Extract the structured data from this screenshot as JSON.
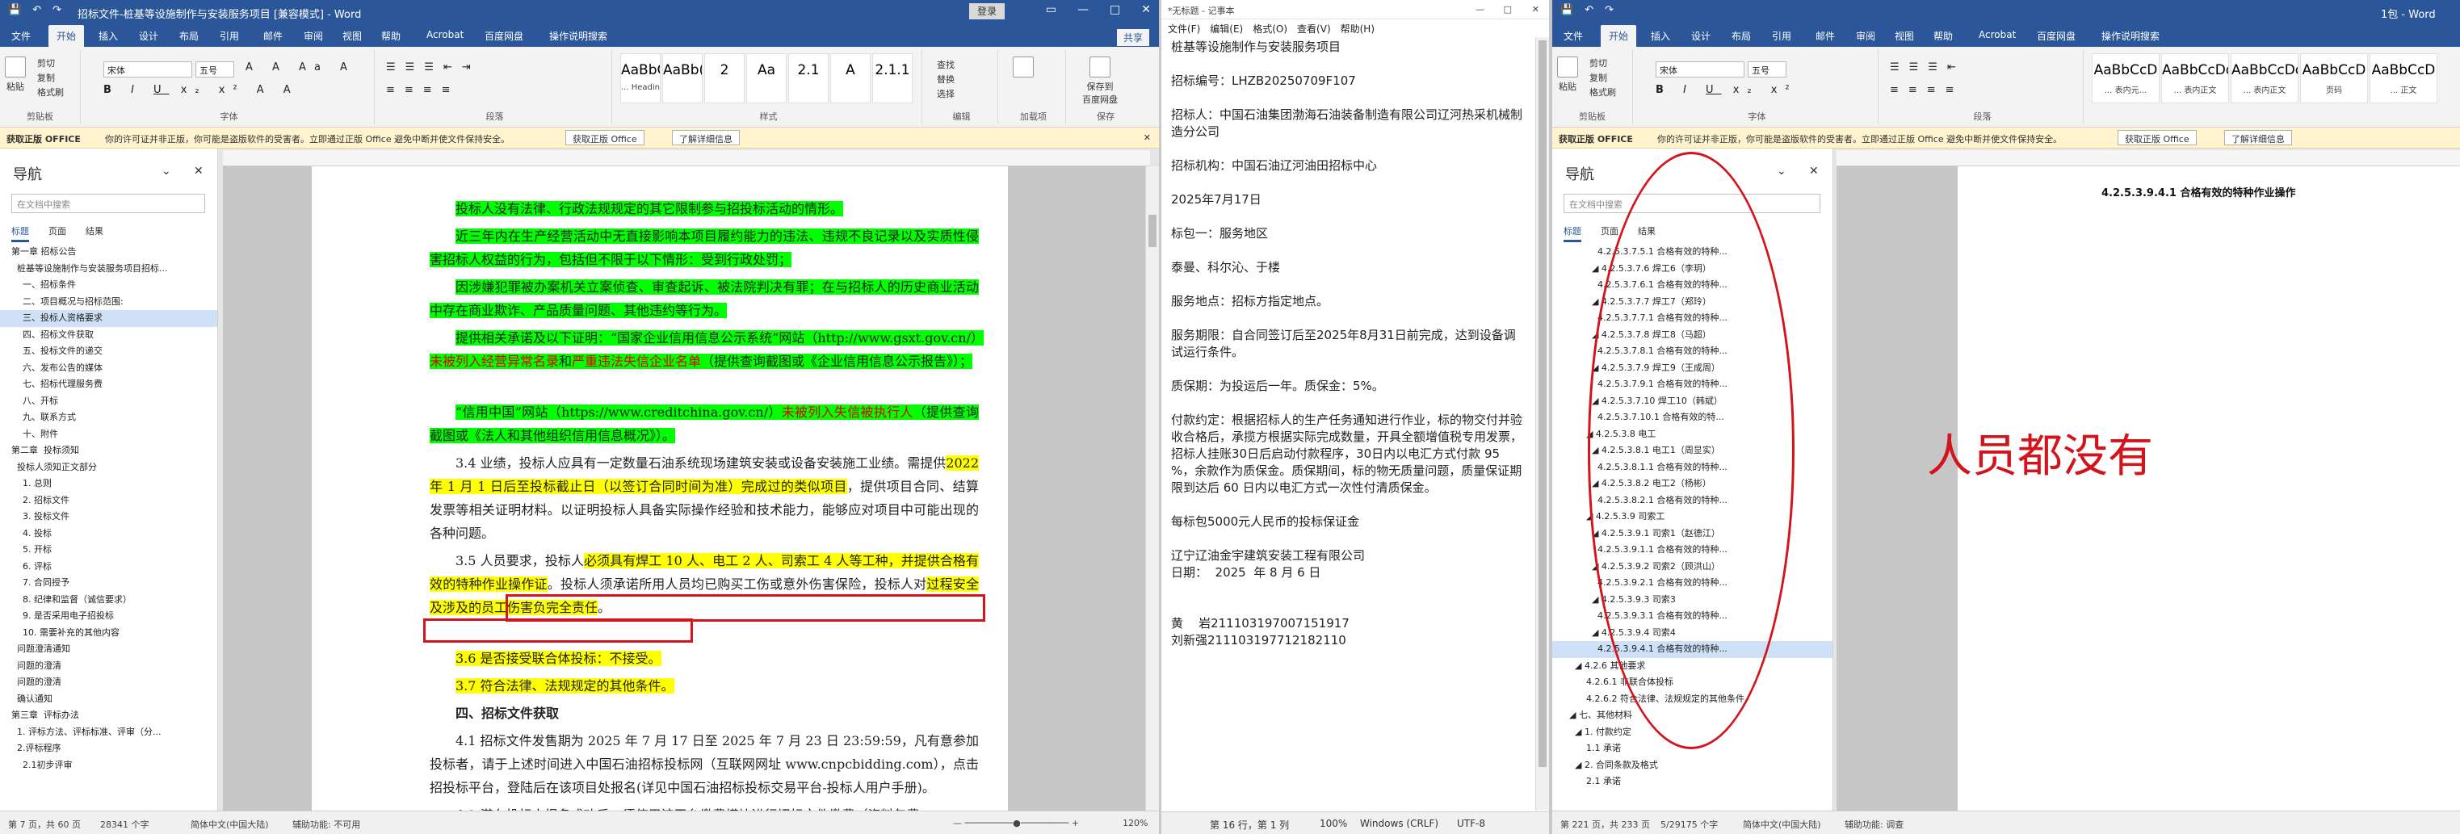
{
  "w1": {
    "title_left": "招标文件-桩基等设施制作与安装服务项目 [兼容模式] - Word",
    "login": "登录",
    "tabs": [
      "文件",
      "开始",
      "插入",
      "设计",
      "布局",
      "引用",
      "邮件",
      "审阅",
      "视图",
      "帮助",
      "Acrobat",
      "百度网盘",
      "操作说明搜索"
    ],
    "share": "共享",
    "clipboard": {
      "paste": "粘贴",
      "cut": "剪切",
      "copy": "复制",
      "format": "格式刷",
      "label": "剪贴板"
    },
    "font": {
      "name": "宋体",
      "size": "五号",
      "label": "字体"
    },
    "para_label": "段落",
    "styles": [
      {
        "sample": "AaBbCcI",
        "name": "... Headin..."
      },
      {
        "sample": "AaBb(",
        "name": ""
      },
      {
        "sample": "2",
        "name": ""
      },
      {
        "sample": "Aa",
        "name": ""
      },
      {
        "sample": "2.1",
        "name": ""
      },
      {
        "sample": "A",
        "name": ""
      },
      {
        "sample": "2.1.1",
        "name": ""
      }
    ],
    "styles_label": "样式",
    "edit": {
      "find": "查找",
      "replace": "替换",
      "select": "选择",
      "label": "编辑"
    },
    "addin": {
      "btn": "加载项",
      "label": "加载项"
    },
    "save": {
      "btn": "保存到\n百度网盘",
      "label": "保存"
    },
    "msg": {
      "prefix": "获取正版 OFFICE",
      "text": "你的许可证并非正版，你可能是盗版软件的受害者。立即通过正版 Office 避免中断并使文件保持安全。",
      "btn1": "获取正版 Office",
      "btn2": "了解详细信息"
    },
    "nav": {
      "title": "导航",
      "search": "在文档中搜索",
      "tabs": [
        "标题",
        "页面",
        "结果"
      ],
      "items": [
        "第一章 招标公告",
        "  桩基等设施制作与安装服务项目招标...",
        "    一、招标条件",
        "    二、项目概况与招标范围:",
        "    三、投标人资格要求",
        "    四、招标文件获取",
        "    五、投标文件的递交",
        "    六、发布公告的媒体",
        "    七、招标代理服务费",
        "    八、开标",
        "    九、联系方式",
        "    十、附件",
        "第二章  投标须知",
        "  投标人须知正文部分",
        "    1. 总则",
        "    2. 招标文件",
        "    3. 投标文件",
        "    4. 投标",
        "    5. 开标",
        "    6. 评标",
        "    7. 合同授予",
        "    8. 纪律和监督（诚信要求）",
        "    9. 是否采用电子招投标",
        "    10. 需要补充的其他内容",
        "  问题澄清通知",
        "  问题的澄清",
        "  问题的澄清",
        "  确认通知",
        "第三章  评标办法",
        "  1. 评标方法、评标标准、评审（分...",
        "  2.评标程序",
        "    2.1初步评审"
      ],
      "sel": 4
    },
    "doc": [
      {
        "segs": [
          {
            "t": "投标人没有法律、行政法规规定的其它限制参与招投标活动的情形。",
            "c": "hl-g"
          }
        ]
      },
      {
        "segs": [
          {
            "t": "近三年内在生产经营活动中无直接影响本项目履约能力的违法、违规不良记录以及实质性侵害招标人权益的行为，包括但不限于以下情形：受到行政处罚；",
            "c": "hl-g"
          }
        ]
      },
      {
        "segs": [
          {
            "t": "因涉嫌犯罪被办案机关立案侦查、审查起诉、被法院判决有罪；在与招标人的历史商业活动中存在商业欺诈、产品质量问题、其他违约等行为。",
            "c": "hl-g"
          }
        ]
      },
      {
        "segs": [
          {
            "t": "提供相关承诺及以下证明：“国家企业信用信息公示系统”网站（http://www.gsxt.gov.cn/）",
            "c": "hl-g"
          },
          {
            "t": "未被列入经营异常名录",
            "c": "hl-g red"
          },
          {
            "t": "和",
            "c": "hl-g"
          },
          {
            "t": "严重违法失信企业名单",
            "c": "hl-g red"
          },
          {
            "t": "（提供查询截图或《企业信用信息公示报告》）；",
            "c": "hl-g"
          }
        ]
      },
      {
        "segs": [
          {
            "t": "“信用中国”网站（https://www.creditchina.gov.cn/）",
            "c": "hl-g"
          },
          {
            "t": "未被列入失信被执行人",
            "c": "hl-g red"
          },
          {
            "t": "（提供查询截图或《法人和其他组织信用信息概况》）。",
            "c": "hl-g"
          }
        ]
      },
      {
        "segs": [
          {
            "t": "3.4 业绩，投标人应具有一定数量石油系统现场建筑安装或设备安装施工业绩。需提供",
            "c": ""
          },
          {
            "t": "2022 年 1 月 1 日后至投标截止日（以签订合同时间为准）完成过的类似项目",
            "c": "hl-y"
          },
          {
            "t": "，提供项目合同、结算发票等相关证明材料。以证明投标人具备实际操作经验和技术能力，能够应对项目中可能出现的各种问题。",
            "c": ""
          }
        ]
      },
      {
        "segs": [
          {
            "t": "3.5 人员要求，投标人",
            "c": ""
          },
          {
            "t": "必须具有焊工 10 人、电工 2 人、司索工 4 人等工种，并提供合格有效的特种作业操作证",
            "c": "hl-y"
          },
          {
            "t": "。投标人须承诺所用人员均已购买工伤或意外伤害保险，投标人对",
            "c": ""
          },
          {
            "t": "过程安全及涉及的员工伤害负完全责任",
            "c": "hl-y"
          },
          {
            "t": "。",
            "c": ""
          }
        ]
      },
      {
        "segs": [
          {
            "t": "3.6 是否接受联合体投标：不接受。",
            "c": "hl-y"
          }
        ]
      },
      {
        "segs": [
          {
            "t": "3.7 符合法律、法规规定的其他条件。",
            "c": "hl-y"
          }
        ]
      },
      {
        "segs": [
          {
            "t": "四、招标文件获取",
            "c": "bold"
          }
        ]
      },
      {
        "segs": [
          {
            "t": "4.1 招标文件发售期为 2025 年 7 月 17 日至 2025 年 7 月 23 日 23:59:59，凡有意参加投标者，请于上述时间进入中国石油招标投标网（互联网网址 www.cnpcbidding.com），点击招投标平台，登陆后在该项目处报名(详见中国石油招标投标交易平台-投标人用户手册)。",
            "c": ""
          }
        ]
      },
      {
        "segs": [
          {
            "t": "4.2 潜在投标人报名成功后，须使用该平台缴费模块进行招标文件缴费（资料包费...",
            "c": ""
          }
        ]
      }
    ],
    "status": [
      "第 7 页，共 60 页",
      "28341 个字",
      "简体中文(中国大陆)",
      "辅助功能: 不可用",
      "120%"
    ]
  },
  "w2": {
    "title": "*无标题 - 记事本",
    "menu": [
      "文件(F)",
      "编辑(E)",
      "格式(O)",
      "查看(V)",
      "帮助(H)"
    ],
    "lines": [
      "桩基等设施制作与安装服务项目",
      "",
      "招标编号：LHZB20250709F107",
      "",
      "招标人：中国石油集团渤海石油装备制造有限公司辽河热采机械制造分公司",
      "",
      "招标机构：中国石油辽河油田招标中心",
      "",
      "2025年7月17日",
      "",
      "标包一：服务地区",
      "",
      "泰曼、科尔沁、于楼",
      "",
      "服务地点：招标方指定地点。",
      "",
      "服务期限：自合同签订后至2025年8月31日前完成，达到设备调试运行条件。",
      "",
      "质保期：为投运后一年。质保金：5%。",
      "",
      "付款约定：根据招标人的生产任务通知进行作业，标的物交付并验收合格后，承揽方根据实际完成数量，开具全额增值税专用发票，招标人挂账30日后启动付款程序，30日内以电汇方式付款 95 %，余款作为质保金。质保期间，标的物无质量问题，质量保证期限到达后 60 日内以电汇方式一次性付清质保金。",
      "",
      "每标包5000元人民币的投标保证金",
      "",
      "辽宁辽油金宇建筑安装工程有限公司",
      "日期：  2025  年 8 月 6 日",
      "",
      "",
      "黄    岩211103197007151917",
      "刘新强211103197712182110"
    ],
    "status": [
      "第 16 行，第 1 列",
      "100%",
      "Windows (CRLF)",
      "UTF-8"
    ]
  },
  "w3": {
    "title": "1包 - Word",
    "tabs": [
      "文件",
      "开始",
      "插入",
      "设计",
      "布局",
      "引用",
      "邮件",
      "审阅",
      "视图",
      "帮助",
      "Acrobat",
      "百度网盘",
      "操作说明搜索"
    ],
    "styles": [
      {
        "sample": "AaBbCcD",
        "name": "... 表内元..."
      },
      {
        "sample": "AaBbCcDdl",
        "name": "... 表内正文"
      },
      {
        "sample": "AaBbCcDdl",
        "name": "... 表内正文"
      },
      {
        "sample": "AaBbCcD",
        "name": "页码"
      },
      {
        "sample": "AaBbCcD",
        "name": "... 正文"
      }
    ],
    "msg": {
      "prefix": "获取正版 OFFICE",
      "text": "你的许可证并非正版，你可能是盗版软件的受害者。立即通过正版 Office 避免中断并使文件保持安全。",
      "btn1": "获取正版 Office",
      "btn2": "了解详细信息"
    },
    "nav": {
      "title": "导航",
      "search": "在文档中搜索",
      "tabs": [
        "标题",
        "页面",
        "结果"
      ],
      "items": [
        "            4.2.5.3.7.5.1 合格有效的特种...",
        "          ◢ 4.2.5.3.7.6 焊工6（李玥）",
        "            4.2.5.3.7.6.1 合格有效的特种...",
        "          ◢ 4.2.5.3.7.7 焊工7（郑玲）",
        "            4.2.5.3.7.7.1 合格有效的特种...",
        "          ◢ 4.2.5.3.7.8 焊工8（马超）",
        "            4.2.5.3.7.8.1 合格有效的特种...",
        "          ◢ 4.2.5.3.7.9 焊工9（王成周）",
        "            4.2.5.3.7.9.1 合格有效的特种...",
        "          ◢ 4.2.5.3.7.10 焊工10（韩斌）",
        "            4.2.5.3.7.10.1 合格有效的特...",
        "        ◢ 4.2.5.3.8 电工",
        "          ◢ 4.2.5.3.8.1 电工1（周显实）",
        "            4.2.5.3.8.1.1 合格有效的特种...",
        "          ◢ 4.2.5.3.8.2 电工2（杨彬）",
        "            4.2.5.3.8.2.1 合格有效的特种...",
        "        ◢ 4.2.5.3.9 司索工",
        "          ◢ 4.2.5.3.9.1 司索1（赵德江）",
        "            4.2.5.3.9.1.1 合格有效的特种...",
        "          ◢ 4.2.5.3.9.2 司索2（顾洪山）",
        "            4.2.5.3.9.2.1 合格有效的特种...",
        "          ◢ 4.2.5.3.9.3 司索3",
        "            4.2.5.3.9.3.1 合格有效的特种...",
        "          ◢ 4.2.5.3.9.4 司索4",
        "            4.2.5.3.9.4.1 合格有效的特种...",
        "    ◢ 4.2.6 其他要求",
        "        4.2.6.1 非联合体投标",
        "        4.2.6.2 符合法律、法规规定的其他条件",
        "  ◢ 七、其他材料",
        "    ◢ 1. 付款约定",
        "        1.1 承诺",
        "    ◢ 2. 合同条款及格式",
        "        2.1 承诺"
      ],
      "sel": 24
    },
    "heading": "4.2.5.3.9.4.1    合格有效的特种作业操作",
    "annotation": "人员都没有",
    "status": [
      "第 221 页，共 233 页",
      "5/29175 个字",
      "简体中文(中国大陆)",
      "辅助功能: 调查"
    ]
  }
}
